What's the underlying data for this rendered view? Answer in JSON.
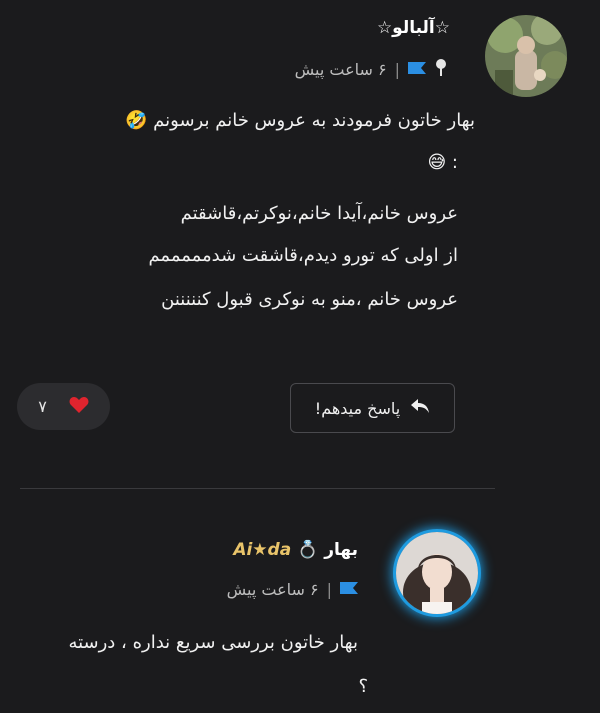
{
  "comment1": {
    "author": "☆آلبالو☆",
    "time": "۶ ساعت پیش",
    "lines": [
      "بهار خاتون فرمودند به عروس خانم برسونم 🤣",
      ": 😅",
      "عروس خانم،آیدا خانم،نوکرتم،قاشقتم",
      "از اولی که تورو دیدم،قاشقت شدمممممم",
      "عروس خانم ،منو به نوکری قبول کنننننن"
    ],
    "reply_label": "پاسخ میدهم!",
    "like_count": "۷"
  },
  "comment2": {
    "author_prefix": "بهار",
    "author_ring": "💍",
    "author_suffix": "Ai★da",
    "time": "۶ ساعت پیش",
    "lines": [
      "بهار خاتون بررسی سریع نداره ، درسته",
      "؟"
    ]
  },
  "colors": {
    "background": "#1b1b1d",
    "flag": "#2b8fe3",
    "heart": "#e0242e",
    "avatar_ring": "#1e9be0"
  },
  "icons": [
    "pin-icon",
    "flag-icon",
    "reply-arrow-icon",
    "heart-icon"
  ]
}
